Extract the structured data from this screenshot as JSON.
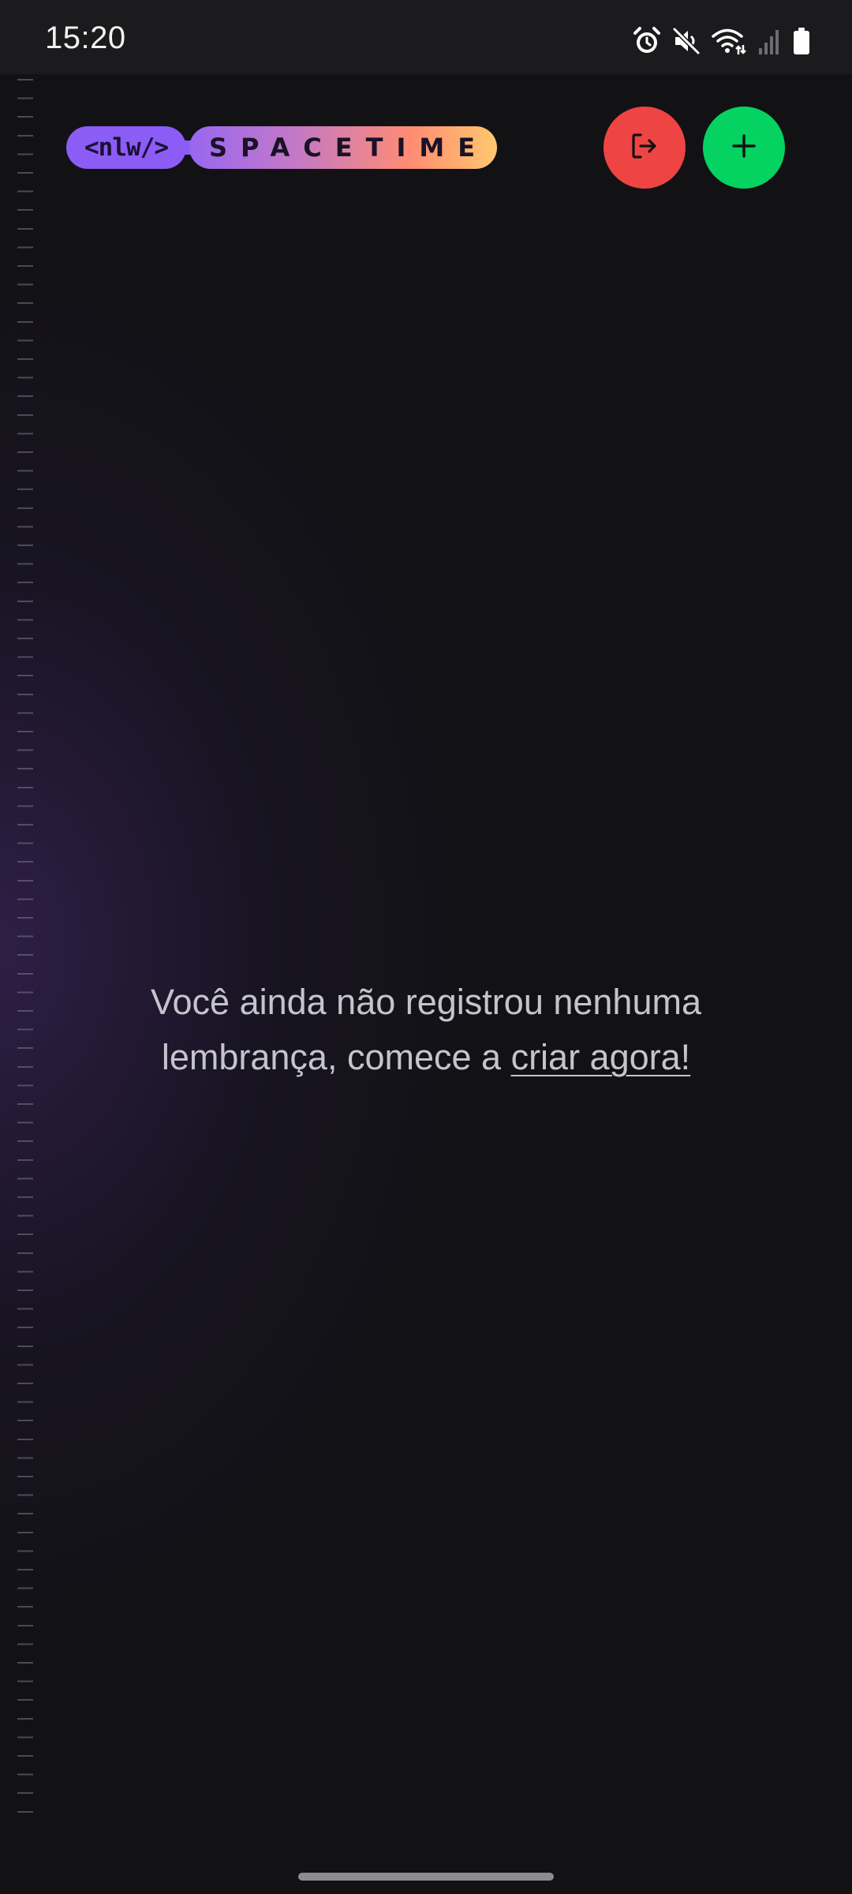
{
  "status_bar": {
    "time": "15:20",
    "icons": [
      "alarm-icon",
      "mute-icon",
      "wifi-icon",
      "signal-icon",
      "battery-icon"
    ]
  },
  "header": {
    "logo": {
      "left_text": "<nlw/>",
      "right_text": "SPACETIME"
    },
    "buttons": {
      "logout": {
        "icon": "logout-icon",
        "color": "#ef4444"
      },
      "add": {
        "icon": "plus-icon",
        "color": "#04d361"
      }
    }
  },
  "empty_state": {
    "message_part1": "Você ainda não registrou nenhuma lembrança, comece a ",
    "link_text": "criar agora!"
  },
  "colors": {
    "background": "#121215",
    "text": "#c4c4cc",
    "brand_purple": "#8b5cf6",
    "brand_gradient_end": "#ffc86e"
  }
}
